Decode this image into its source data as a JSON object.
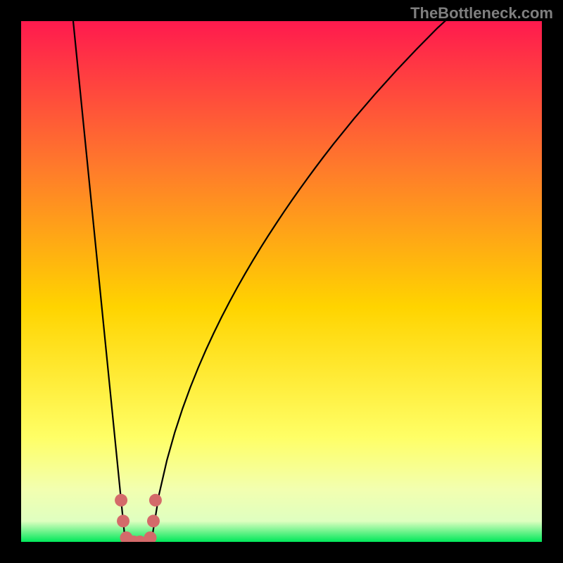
{
  "watermark": "TheBottleneck.com",
  "chart_data": {
    "type": "line",
    "xlabel": "",
    "ylabel": "",
    "title": "",
    "xlim": [
      0,
      100
    ],
    "ylim": [
      0,
      100
    ],
    "gradient_colors": {
      "top": "#FF1A4E",
      "upper_mid": "#FF7A2B",
      "mid": "#FFD400",
      "lower_mid": "#FFFF66",
      "pale_band": "#F2FFB0",
      "bottom_green": "#00E85A"
    },
    "curve_left": [
      {
        "x": 10.0,
        "y": 100.0
      },
      {
        "x": 11.0,
        "y": 90.0
      },
      {
        "x": 12.0,
        "y": 80.0
      },
      {
        "x": 13.0,
        "y": 70.0
      },
      {
        "x": 14.0,
        "y": 60.0
      },
      {
        "x": 15.0,
        "y": 50.0
      },
      {
        "x": 16.0,
        "y": 40.0
      },
      {
        "x": 17.0,
        "y": 30.0
      },
      {
        "x": 18.0,
        "y": 20.0
      },
      {
        "x": 19.0,
        "y": 10.0
      },
      {
        "x": 20.0,
        "y": 0.0
      }
    ],
    "curve_right": [
      {
        "x": 25.0,
        "y": 0.0
      },
      {
        "x": 26.5,
        "y": 9.18
      },
      {
        "x": 28.0,
        "y": 15.69
      },
      {
        "x": 29.5,
        "y": 21.01
      },
      {
        "x": 31.0,
        "y": 25.6
      },
      {
        "x": 32.5,
        "y": 29.7
      },
      {
        "x": 34.0,
        "y": 33.43
      },
      {
        "x": 35.5,
        "y": 36.89
      },
      {
        "x": 37.0,
        "y": 40.12
      },
      {
        "x": 38.5,
        "y": 43.17
      },
      {
        "x": 40.0,
        "y": 46.07
      },
      {
        "x": 41.5,
        "y": 48.83
      },
      {
        "x": 43.0,
        "y": 51.48
      },
      {
        "x": 44.5,
        "y": 54.03
      },
      {
        "x": 46.0,
        "y": 56.49
      },
      {
        "x": 47.5,
        "y": 58.87
      },
      {
        "x": 49.0,
        "y": 61.17
      },
      {
        "x": 50.5,
        "y": 63.42
      },
      {
        "x": 52.0,
        "y": 65.6
      },
      {
        "x": 53.5,
        "y": 67.73
      },
      {
        "x": 55.0,
        "y": 69.81
      },
      {
        "x": 56.5,
        "y": 71.85
      },
      {
        "x": 58.0,
        "y": 73.84
      },
      {
        "x": 60.0,
        "y": 76.43
      },
      {
        "x": 64.0,
        "y": 81.36
      },
      {
        "x": 68.0,
        "y": 86.02
      },
      {
        "x": 72.0,
        "y": 90.45
      },
      {
        "x": 76.0,
        "y": 94.68
      },
      {
        "x": 80.0,
        "y": 98.73
      },
      {
        "x": 100.0,
        "y": 116.96
      }
    ],
    "markers": [
      {
        "x": 19.2,
        "y": 8.0
      },
      {
        "x": 19.6,
        "y": 4.0
      },
      {
        "x": 20.2,
        "y": 0.8
      },
      {
        "x": 21.6,
        "y": 0.0
      },
      {
        "x": 22.8,
        "y": 0.0
      },
      {
        "x": 24.8,
        "y": 0.8
      },
      {
        "x": 25.4,
        "y": 4.0
      },
      {
        "x": 25.8,
        "y": 8.0
      }
    ],
    "marker_color": "#D46A6A",
    "curve_color": "#000000"
  }
}
